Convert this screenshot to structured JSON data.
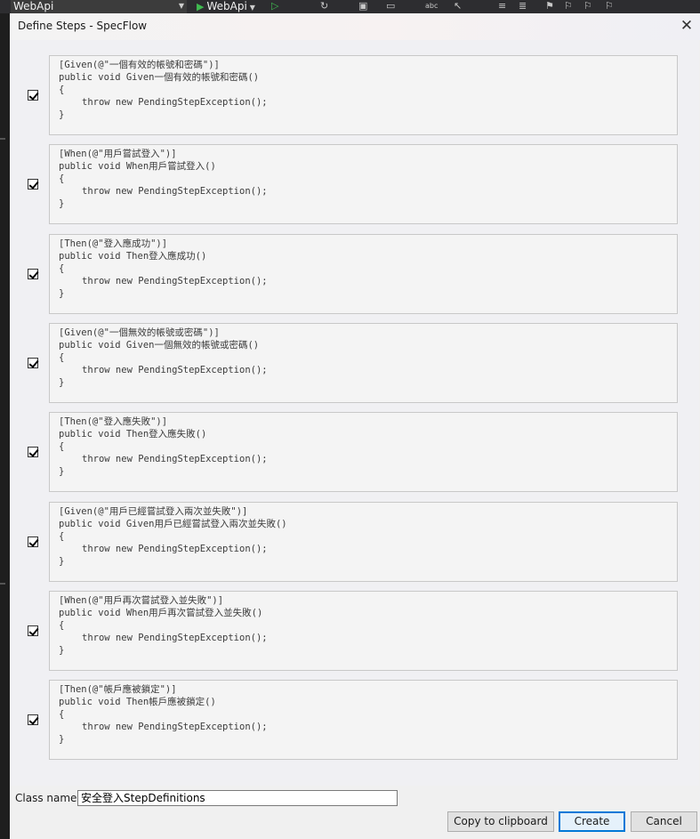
{
  "ide": {
    "config_label": "WebApi",
    "run_label": "WebApi"
  },
  "dialog": {
    "title": "Define Steps - SpecFlow",
    "close_glyph": "✕"
  },
  "steps": [
    {
      "checked": true,
      "attribute": "[Given(@\"一個有效的帳號和密碼\")]",
      "signature": "public void Given一個有效的帳號和密碼()",
      "open_brace": "{",
      "body": "throw new PendingStepException();",
      "close_brace": "}"
    },
    {
      "checked": true,
      "attribute": "[When(@\"用戶嘗試登入\")]",
      "signature": "public void When用戶嘗試登入()",
      "open_brace": "{",
      "body": "throw new PendingStepException();",
      "close_brace": "}"
    },
    {
      "checked": true,
      "attribute": "[Then(@\"登入應成功\")]",
      "signature": "public void Then登入應成功()",
      "open_brace": "{",
      "body": "throw new PendingStepException();",
      "close_brace": "}"
    },
    {
      "checked": true,
      "attribute": "[Given(@\"一個無效的帳號或密碼\")]",
      "signature": "public void Given一個無效的帳號或密碼()",
      "open_brace": "{",
      "body": "throw new PendingStepException();",
      "close_brace": "}"
    },
    {
      "checked": true,
      "attribute": "[Then(@\"登入應失敗\")]",
      "signature": "public void Then登入應失敗()",
      "open_brace": "{",
      "body": "throw new PendingStepException();",
      "close_brace": "}"
    },
    {
      "checked": true,
      "attribute": "[Given(@\"用戶已經嘗試登入兩次並失敗\")]",
      "signature": "public void Given用戶已經嘗試登入兩次並失敗()",
      "open_brace": "{",
      "body": "throw new PendingStepException();",
      "close_brace": "}"
    },
    {
      "checked": true,
      "attribute": "[When(@\"用戶再次嘗試登入並失敗\")]",
      "signature": "public void When用戶再次嘗試登入並失敗()",
      "open_brace": "{",
      "body": "throw new PendingStepException();",
      "close_brace": "}"
    },
    {
      "checked": true,
      "attribute": "[Then(@\"帳戶應被鎖定\")]",
      "signature": "public void Then帳戶應被鎖定()",
      "open_brace": "{",
      "body": "throw new PendingStepException();",
      "close_brace": "}"
    }
  ],
  "class_name": {
    "label": "Class name:",
    "value": "安全登入StepDefinitions"
  },
  "buttons": {
    "copy": "Copy to clipboard",
    "create": "Create",
    "cancel": "Cancel"
  }
}
